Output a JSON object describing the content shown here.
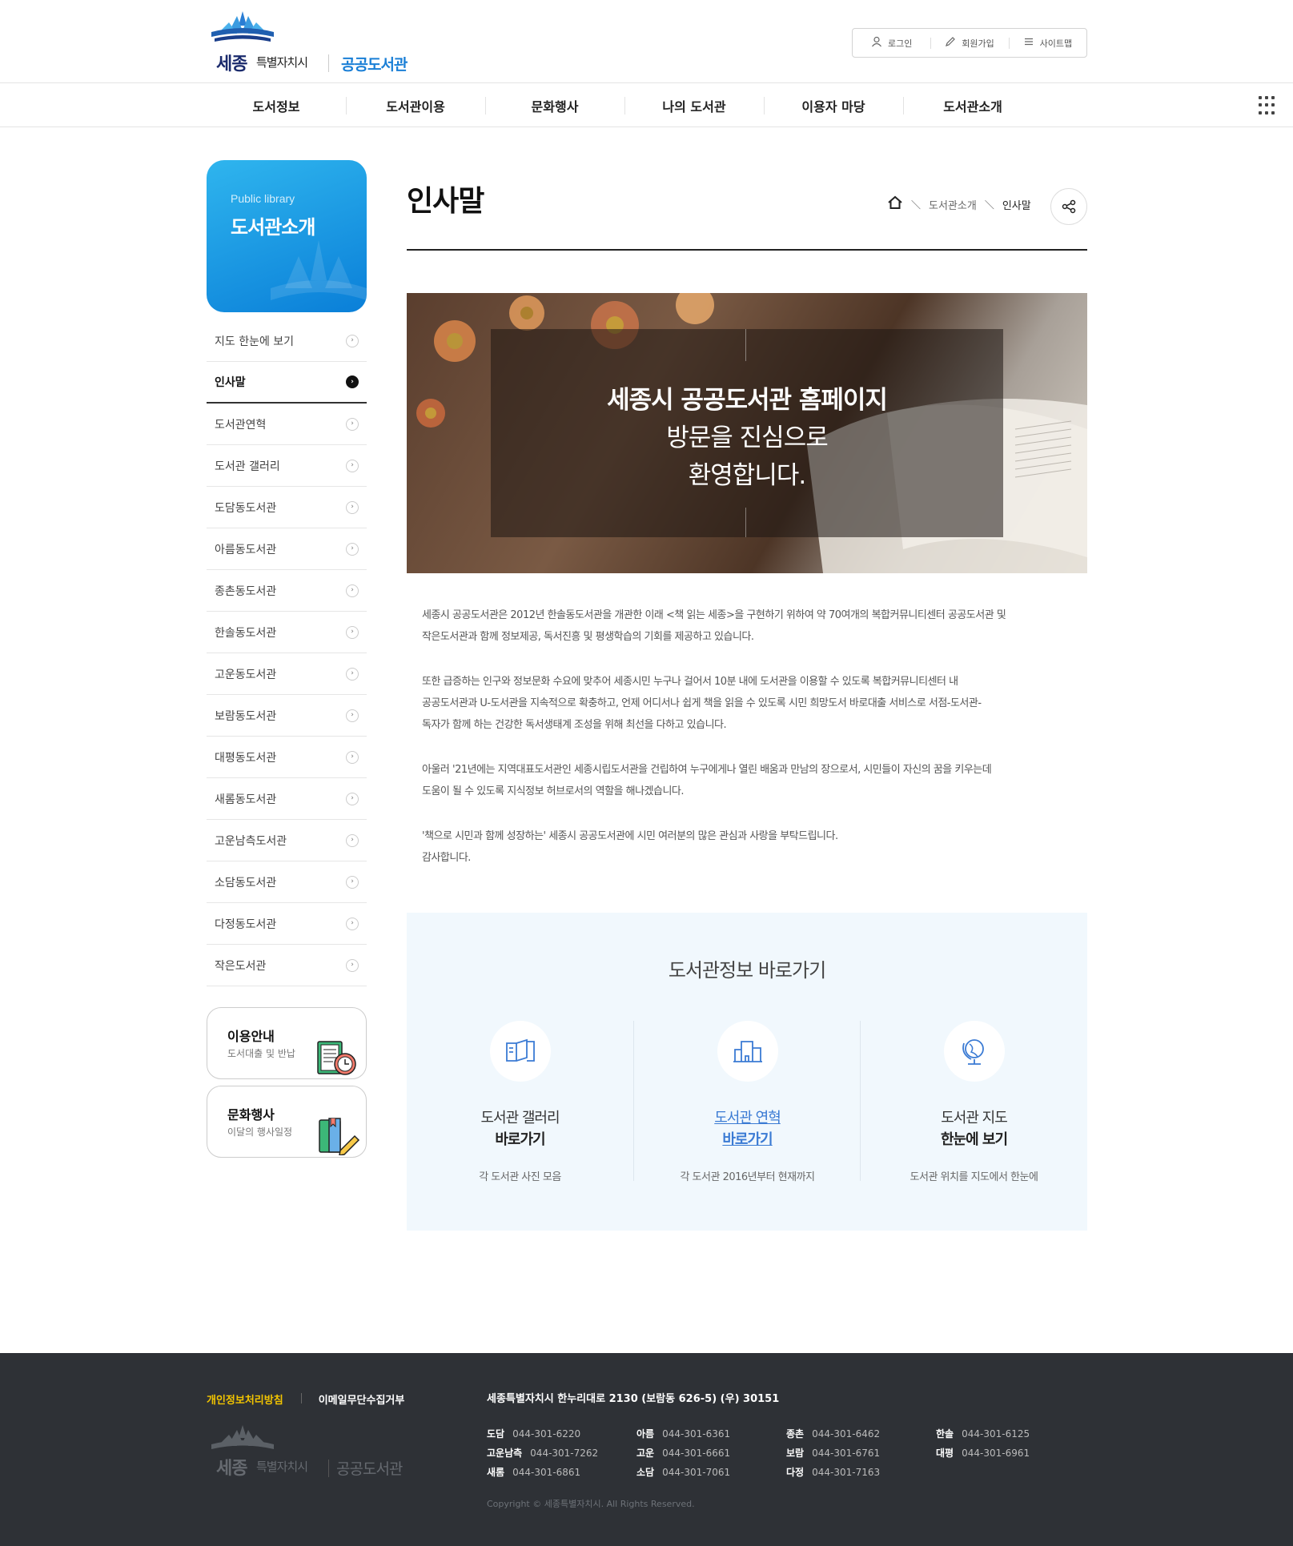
{
  "header": {
    "logo_sejong": "세종",
    "logo_sub": "특별자치시",
    "logo_lib": "공공도서관",
    "util": [
      {
        "label": "로그인",
        "icon": "user-icon"
      },
      {
        "label": "회원가입",
        "icon": "pencil-icon"
      },
      {
        "label": "사이트맵",
        "icon": "menu-icon"
      }
    ]
  },
  "gnb": [
    "도서정보",
    "도서관이용",
    "문화행사",
    "나의 도서관",
    "이용자 마당",
    "도서관소개"
  ],
  "lnb": {
    "en": "Public library",
    "title": "도서관소개",
    "items": [
      "지도 한눈에 보기",
      "인사말",
      "도서관연혁",
      "도서관 갤러리",
      "도담동도서관",
      "아름동도서관",
      "종촌동도서관",
      "한솔동도서관",
      "고운동도서관",
      "보람동도서관",
      "대평동도서관",
      "새롬동도서관",
      "고운남측도서관",
      "소담동도서관",
      "다정동도서관",
      "작은도서관"
    ],
    "active_index": 1,
    "quick": [
      {
        "title": "이용안내",
        "sub": "도서대출 및 반납"
      },
      {
        "title": "문화행사",
        "sub": "이달의 행사일정"
      }
    ]
  },
  "content": {
    "title": "인사말",
    "breadcrumb": [
      "도서관소개",
      "인사말"
    ],
    "hero": {
      "line1": "세종시 공공도서관 홈페이지",
      "line2": "방문을 진심으로",
      "line3": "환영합니다."
    },
    "paragraphs": [
      [
        "세종시 공공도서관은 2012년 한솔동도서관을 개관한 이래 <책 읽는 세종>을 구현하기 위하여 약 70여개의 복합커뮤니티센터 공공도서관 및",
        "작은도서관과 함께 정보제공, 독서진흥 및 평생학습의 기회를 제공하고 있습니다."
      ],
      [
        "또한 급증하는 인구와 정보문화 수요에 맞추어 세종시민 누구나 걸어서 10분 내에 도서관을 이용할 수 있도록 복합커뮤니티센터 내",
        "공공도서관과 U-도서관을 지속적으로 확충하고, 언제 어디서나 쉽게 책을 읽을 수 있도록 시민 희망도서 바로대출 서비스로 서점-도서관-",
        "독자가 함께 하는 건강한 독서생태계 조성을 위해 최선을 다하고 있습니다."
      ],
      [
        "아울러 '21년에는 지역대표도서관인 세종시립도서관을 건립하여 누구에게나 열린 배움과 만남의 장으로서, 시민들이 자신의 꿈을 키우는데",
        "도움이 될 수 있도록 지식정보 허브로서의 역할을 해나겠습니다."
      ],
      [
        "'책으로 시민과 함께 성장하는' 세종시 공공도서관에 시민 여러분의 많은 관심과 사랑을 부탁드립니다.",
        "감사합니다."
      ]
    ],
    "quick_title": "도서관정보 바로가기",
    "quick_items": [
      {
        "t1": "도서관 갤러리",
        "t2": "바로가기",
        "desc": "각 도서관 사진 모음",
        "icon": "book-icon"
      },
      {
        "t1": "도서관 연혁",
        "t2": "바로가기",
        "desc": "각 도서관 2016년부터 현재까지",
        "icon": "building-icon"
      },
      {
        "t1": "도서관 지도",
        "t2": "한눈에 보기",
        "desc": "도서관 위치를 지도에서 한눈에",
        "icon": "globe-icon"
      }
    ]
  },
  "footer": {
    "policy": "개인정보처리방침",
    "email": "이메일무단수집거부",
    "address": "세종특별자치시 한누리대로 2130 (보람동 626-5) (우) 30151",
    "phones": [
      {
        "name": "도담",
        "tel": "044-301-6220"
      },
      {
        "name": "아름",
        "tel": "044-301-6361"
      },
      {
        "name": "종촌",
        "tel": "044-301-6462"
      },
      {
        "name": "한솔",
        "tel": "044-301-6125"
      },
      {
        "name": "고운남측",
        "tel": "044-301-7262"
      },
      {
        "name": "고운",
        "tel": "044-301-6661"
      },
      {
        "name": "보람",
        "tel": "044-301-6761"
      },
      {
        "name": "대평",
        "tel": "044-301-6961"
      },
      {
        "name": "새롬",
        "tel": "044-301-6861"
      },
      {
        "name": "소담",
        "tel": "044-301-7061"
      },
      {
        "name": "다정",
        "tel": "044-301-7163"
      }
    ],
    "copyright": "Copyright © 세종특별자치시. All Rights Reserved.",
    "logo_sejong": "세종",
    "logo_sub": "특별자치시",
    "logo_lib": "공공도서관"
  },
  "colors": {
    "accent": "#0a7fd8",
    "footer_bg": "#2e3136",
    "link": "#3b7bd4",
    "policy": "#f2c400"
  }
}
